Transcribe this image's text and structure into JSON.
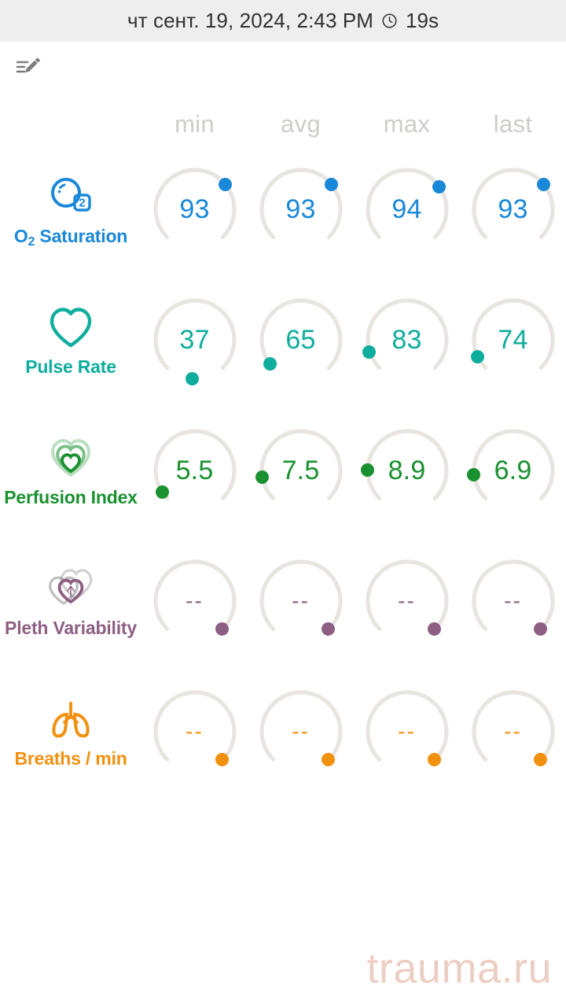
{
  "statusbar": {
    "datetime": "чт сент. 19, 2024, 2:43 PM",
    "clock_icon": "clock-icon",
    "elapsed": "19s"
  },
  "toolbar": {
    "edit_note_icon": "edit-note-icon"
  },
  "table": {
    "columns": [
      "min",
      "avg",
      "max",
      "last"
    ]
  },
  "colors": {
    "o2": "#1a88d8",
    "pulse": "#0fad9d",
    "perfusion": "#1a9130",
    "pleth": "#8d5f83",
    "breaths": "#f2900f",
    "track": "#e8e5e0",
    "header_text": "#cfcdca",
    "watermark": "#eccfc4",
    "statusbar_bg": "#eeeeee"
  },
  "metrics": [
    {
      "name": "O₂ Saturation",
      "label_main": "O",
      "label_sub": "2",
      "label_rest": " Saturation",
      "icon": "o2-molecule-icon",
      "color": "#1a88d8",
      "values": [
        "93",
        "93",
        "94",
        "93"
      ],
      "dot_angles": [
        51,
        51,
        55,
        51
      ]
    },
    {
      "name": "Pulse Rate",
      "icon": "heart-outline-icon",
      "color": "#0fad9d",
      "values": [
        "37",
        "65",
        "83",
        "74"
      ],
      "dot_angles": [
        184,
        232,
        252,
        244
      ]
    },
    {
      "name": "Perfusion Index",
      "icon": "triple-heart-icon",
      "color": "#1a9130",
      "values": [
        "5.5",
        "7.5",
        "8.9",
        "6.9"
      ],
      "dot_angles": [
        236,
        260,
        271,
        264
      ]
    },
    {
      "name": "Pleth Variability",
      "icon": "double-heart-icon",
      "color": "#8d5f83",
      "values": [
        "--",
        "--",
        "--",
        "--"
      ],
      "dot_angles": [
        136,
        136,
        136,
        136
      ]
    },
    {
      "name": "Breaths / min",
      "icon": "lungs-icon",
      "color": "#f2900f",
      "values": [
        "--",
        "--",
        "--",
        "--"
      ],
      "dot_angles": [
        136,
        136,
        136,
        136
      ]
    }
  ],
  "watermark": "trauma.ru"
}
